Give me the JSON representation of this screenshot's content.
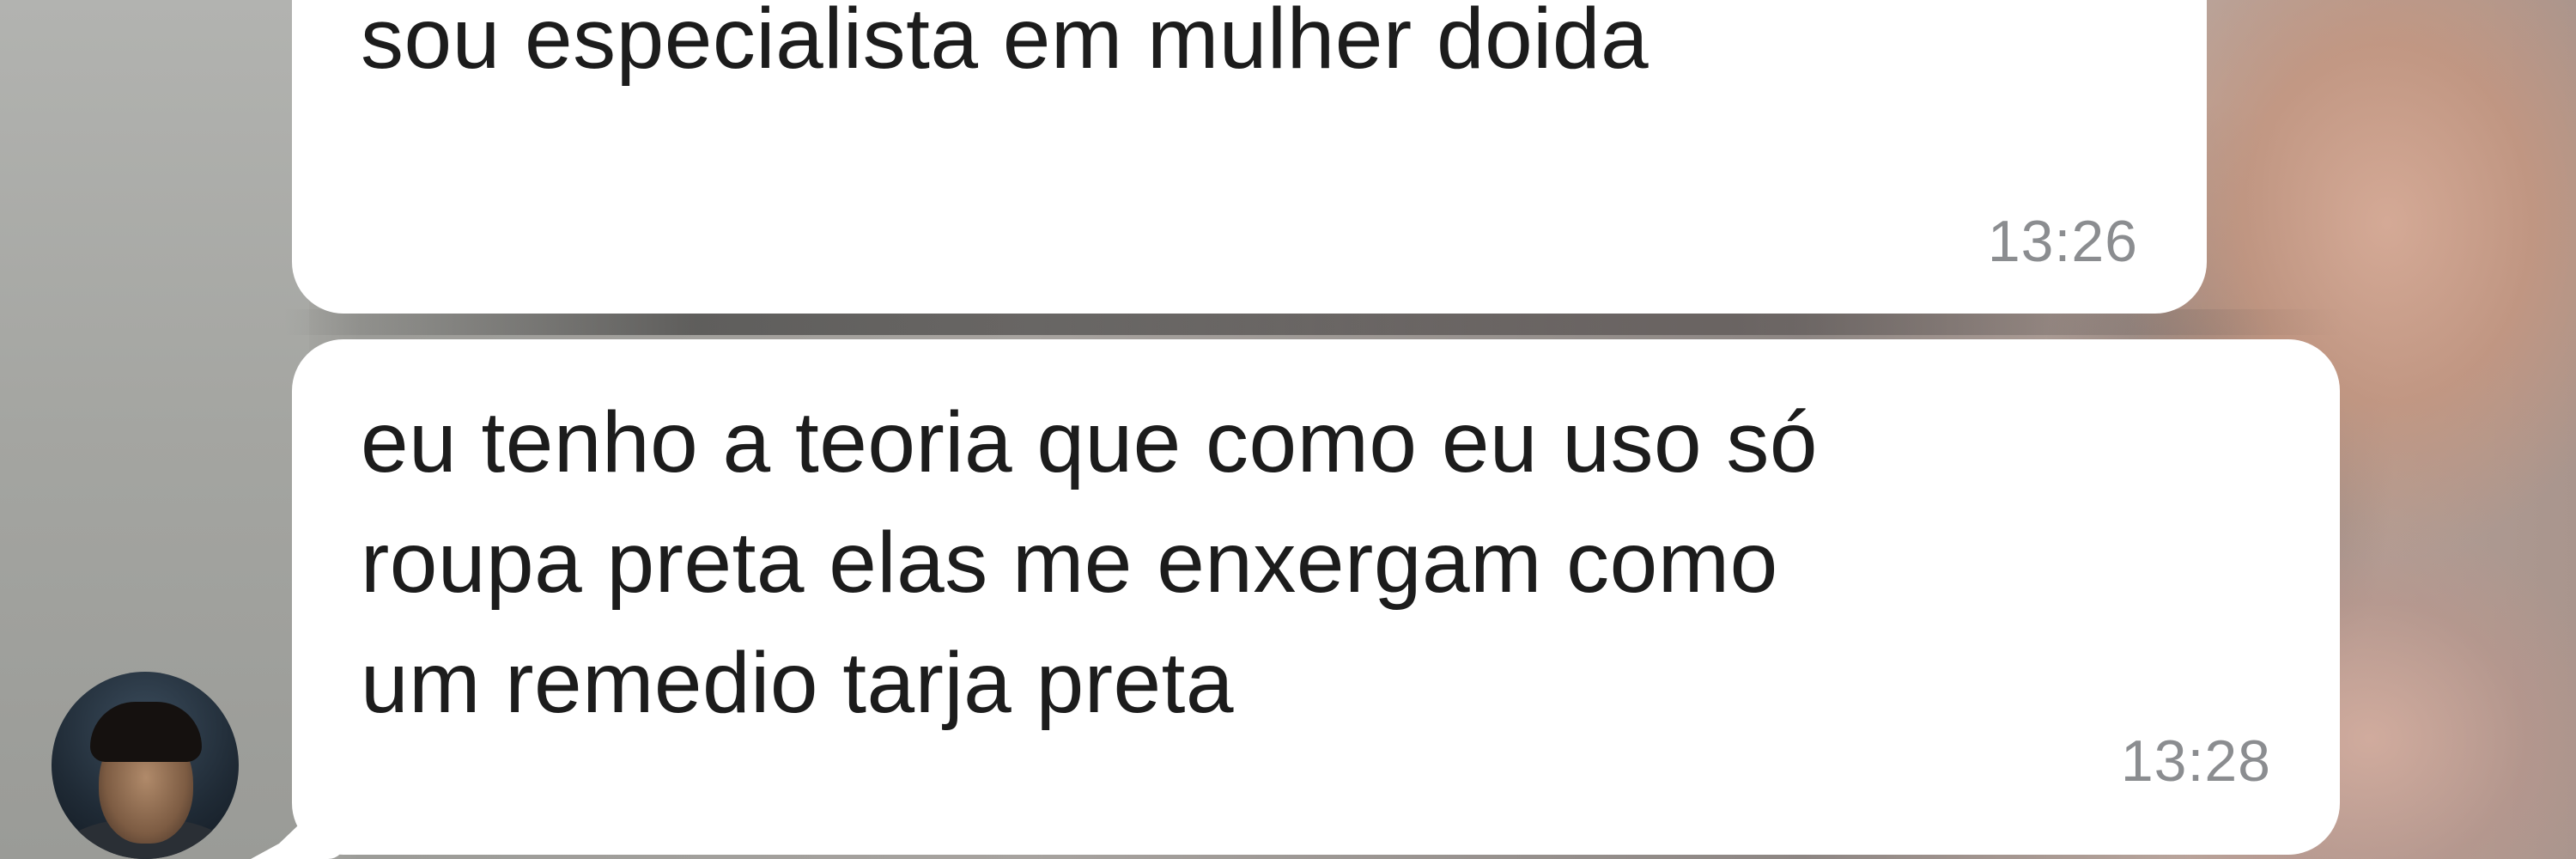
{
  "chat": {
    "messages": [
      {
        "text": "sou especialista em mulher doida",
        "time": "13:26"
      },
      {
        "text": "eu tenho a teoria que como eu uso só\nroupa preta elas me enxergam como\num remedio tarja preta",
        "time": "13:28"
      }
    ]
  },
  "theme": {
    "bubble_color": "#ffffff",
    "text_color": "#1c1c1c",
    "time_color": "#8b8d90"
  }
}
